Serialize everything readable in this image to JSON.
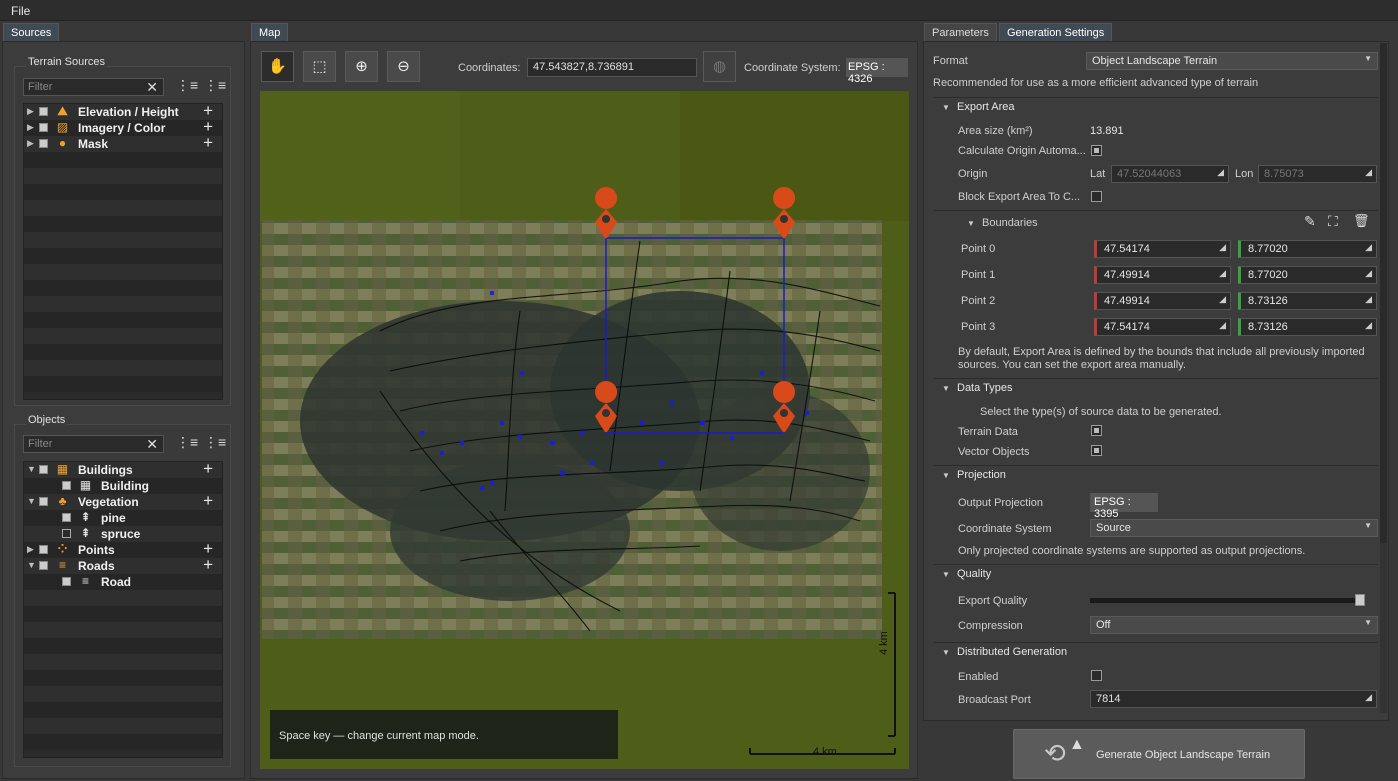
{
  "menubar": {
    "file": "File"
  },
  "left": {
    "tab": "Sources",
    "terrain": {
      "title": "Terrain Sources",
      "filter_placeholder": "Filter",
      "items": [
        {
          "label": "Elevation / Height",
          "icon": "mountain-icon"
        },
        {
          "label": "Imagery / Color",
          "icon": "image-icon"
        },
        {
          "label": "Mask",
          "icon": "mask-icon"
        }
      ]
    },
    "objects": {
      "title": "Objects",
      "filter_placeholder": "Filter",
      "items": [
        {
          "label": "Buildings",
          "icon": "buildings-icon",
          "level": 0
        },
        {
          "label": "Building",
          "icon": "building-icon",
          "level": 1
        },
        {
          "label": "Vegetation",
          "icon": "tree-icon",
          "level": 0
        },
        {
          "label": "pine",
          "icon": "pine-icon",
          "level": 1
        },
        {
          "label": "spruce",
          "icon": "spruce-icon",
          "level": 1
        },
        {
          "label": "Points",
          "icon": "points-icon",
          "level": 0
        },
        {
          "label": "Roads",
          "icon": "roads-icon",
          "level": 0
        },
        {
          "label": "Road",
          "icon": "road-icon",
          "level": 1
        }
      ]
    }
  },
  "map": {
    "tab": "Map",
    "coordinates_label": "Coordinates:",
    "coordinates_value": "47.543827,8.736891",
    "coordinate_system_label": "Coordinate System:",
    "coordinate_system_value": "EPSG : 4326",
    "hint": "Space key — change current map mode.",
    "scale_vertical": "4 km",
    "scale_horizontal": "4 km"
  },
  "right": {
    "tabs": [
      "Parameters",
      "Generation Settings"
    ],
    "format_label": "Format",
    "format_value": "Object Landscape Terrain",
    "format_hint": "Recommended for use as a more efficient advanced type of terrain",
    "export_area": {
      "title": "Export Area",
      "area_label": "Area size (km²)",
      "area_value": "13.891",
      "calc_origin": "Calculate Origin Automa...",
      "origin_label": "Origin",
      "lat_label": "Lat",
      "lat_value": "47.52044063",
      "lon_label": "Lon",
      "lon_value": "8.75073",
      "block_label": "Block Export Area To C...",
      "boundaries_title": "Boundaries",
      "points": [
        {
          "label": "Point 0",
          "lat": "47.54174",
          "lon": "8.77020"
        },
        {
          "label": "Point 1",
          "lat": "47.49914",
          "lon": "8.77020"
        },
        {
          "label": "Point 2",
          "lat": "47.49914",
          "lon": "8.73126"
        },
        {
          "label": "Point 3",
          "lat": "47.54174",
          "lon": "8.73126"
        }
      ],
      "note": "By default, Export Area is defined by the bounds that include all previously imported sources. You can set the export area manually."
    },
    "data_types": {
      "title": "Data Types",
      "hint": "Select the type(s) of source data to be generated.",
      "terrain": "Terrain Data",
      "vector": "Vector Objects"
    },
    "projection": {
      "title": "Projection",
      "output_label": "Output Projection",
      "output_value": "EPSG : 3395",
      "cs_label": "Coordinate System",
      "cs_value": "Source",
      "note": "Only projected coordinate systems are supported as output projections."
    },
    "quality": {
      "title": "Quality",
      "export_label": "Export Quality",
      "export_level": 1.0,
      "compression_label": "Compression",
      "compression_value": "Off"
    },
    "distributed": {
      "title": "Distributed Generation",
      "enabled_label": "Enabled",
      "port_label": "Broadcast Port",
      "port_value": "7814"
    },
    "generate_button": "Generate Object Landscape Terrain"
  },
  "colors": {
    "accent_orange": "#f0a030",
    "map_bg": "#4d5c16",
    "export_box": "#1a1ad0",
    "pin": "#d84a1a"
  }
}
